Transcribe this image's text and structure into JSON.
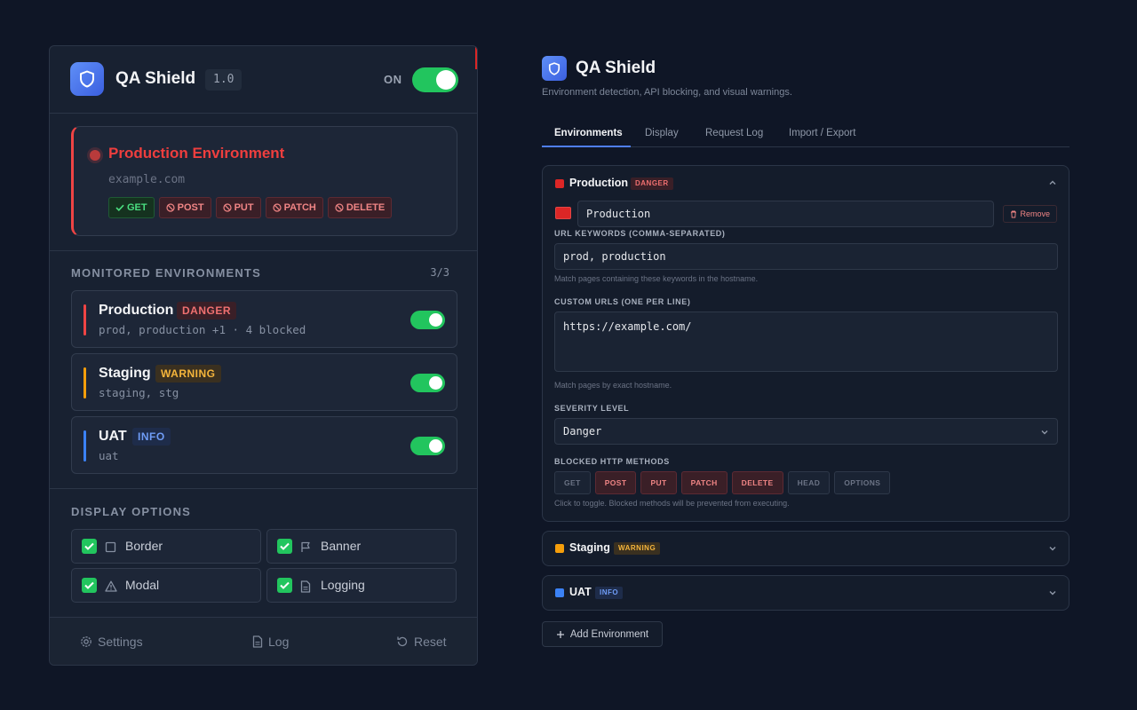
{
  "popup": {
    "app_title": "QA Shield",
    "version": "1.0",
    "power_label": "ON",
    "alert": {
      "title": "Production Environment",
      "domain": "example.com",
      "methods": [
        {
          "label": "GET",
          "allowed": true
        },
        {
          "label": "POST",
          "allowed": false
        },
        {
          "label": "PUT",
          "allowed": false
        },
        {
          "label": "PATCH",
          "allowed": false
        },
        {
          "label": "DELETE",
          "allowed": false
        }
      ]
    },
    "monitored": {
      "title": "MONITORED ENVIRONMENTS",
      "count": "3/3",
      "items": [
        {
          "name": "Production",
          "badge": "DANGER",
          "sub": "prod, production +1 · 4 blocked",
          "color": "#ef4444",
          "enabled": true
        },
        {
          "name": "Staging",
          "badge": "WARNING",
          "sub": "staging, stg",
          "color": "#f59e0b",
          "enabled": true
        },
        {
          "name": "UAT",
          "badge": "INFO",
          "sub": "uat",
          "color": "#3b82f6",
          "enabled": true
        }
      ]
    },
    "display": {
      "title": "DISPLAY OPTIONS",
      "options": [
        {
          "label": "Border",
          "icon": "square-icon",
          "checked": true
        },
        {
          "label": "Banner",
          "icon": "flag-icon",
          "checked": true
        },
        {
          "label": "Modal",
          "icon": "warning-icon",
          "checked": true
        },
        {
          "label": "Logging",
          "icon": "file-icon",
          "checked": true
        }
      ]
    },
    "footer": {
      "settings": "Settings",
      "log": "Log",
      "reset": "Reset"
    }
  },
  "settings": {
    "title": "QA Shield",
    "subtitle": "Environment detection, API blocking, and visual warnings.",
    "tabs": [
      "Environments",
      "Display",
      "Request Log",
      "Import / Export"
    ],
    "active_tab": "Environments",
    "production": {
      "name": "Production",
      "badge": "DANGER",
      "color": "#dc2626",
      "name_value": "Production",
      "remove_label": "Remove",
      "keywords_label": "URL KEYWORDS (COMMA-SEPARATED)",
      "keywords_value": "prod, production",
      "keywords_help": "Match pages containing these keywords in the hostname.",
      "urls_label": "CUSTOM URLS (ONE PER LINE)",
      "urls_value": "https://example.com/",
      "urls_help": "Match pages by exact hostname.",
      "severity_label": "SEVERITY LEVEL",
      "severity_value": "Danger",
      "methods_label": "BLOCKED HTTP METHODS",
      "methods": [
        {
          "label": "GET",
          "blocked": false
        },
        {
          "label": "POST",
          "blocked": true
        },
        {
          "label": "PUT",
          "blocked": true
        },
        {
          "label": "PATCH",
          "blocked": true
        },
        {
          "label": "DELETE",
          "blocked": true
        },
        {
          "label": "HEAD",
          "blocked": false
        },
        {
          "label": "OPTIONS",
          "blocked": false
        }
      ],
      "methods_help": "Click to toggle. Blocked methods will be prevented from executing."
    },
    "staging": {
      "name": "Staging",
      "badge": "WARNING",
      "color": "#f59e0b"
    },
    "uat": {
      "name": "UAT",
      "badge": "INFO",
      "color": "#3b82f6"
    },
    "add_label": "Add Environment"
  }
}
